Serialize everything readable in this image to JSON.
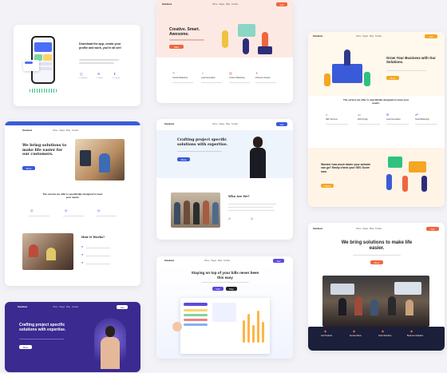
{
  "brand": "Sandeza",
  "card1": {
    "headline": "Download the app, create your profile and work, you're all set!",
    "features": [
      "1. Register",
      "2. Build",
      "3. Launch"
    ]
  },
  "card2": {
    "headline": "Creative. Smart. Awesome.",
    "accent": "#f0653d",
    "services": [
      "Growth Marketing",
      "Lead Generation",
      "Content Marketing",
      "Influencer Design"
    ]
  },
  "card3": {
    "headline": "Grow Your Business with Our Solutions.",
    "section_title": "The service we offer is specifically designed to meet your needs.",
    "services": [
      "SEO Services",
      "Web Design",
      "Lead Generation",
      "Social Marketing"
    ],
    "cta_title": "Wonder how much faster your website can go? Easily check your SEO Score now.",
    "accent": "#f5a623"
  },
  "card4": {
    "headline": "We bring solutions to make life easier for our customers.",
    "section_title": "The service we offer is specifically designed to meet your needs.",
    "process_title": "How it Works?",
    "accent": "#3a5bd9"
  },
  "card5": {
    "headline": "Crafting project specific solutions with expertise.",
    "about_title": "Who Are We?",
    "accent": "#3a5bd9"
  },
  "card6": {
    "headline": "Crafting project specific solutions with expertise.",
    "accent": "#3b2a8f"
  },
  "card7": {
    "headline": "Staying on top of your bills never been this easy",
    "accent": "#5b4be0"
  },
  "card8": {
    "headline": "We bring solutions to make life easier.",
    "accent": "#f0653d",
    "features": [
      "Our Products",
      "Service Plans",
      "Team Members",
      "Business Solutions"
    ]
  },
  "colors": {
    "blue": "#3a5bd9",
    "orange": "#f0653d",
    "navy": "#1c1f3a",
    "purple": "#3b2a8f",
    "green": "#2ec27e"
  }
}
